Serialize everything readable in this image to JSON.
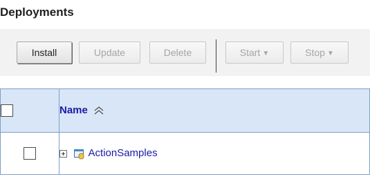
{
  "page": {
    "title": "Deployments"
  },
  "toolbar": {
    "install_label": "Install",
    "update_label": "Update",
    "delete_label": "Delete",
    "start_label": "Start",
    "stop_label": "Stop"
  },
  "table": {
    "columns": [
      {
        "label": "Name",
        "sort_icon": "sort-icon"
      }
    ],
    "rows": [
      {
        "name": "ActionSamples",
        "icon": "application-icon",
        "expand_icon": "expand-icon"
      }
    ]
  },
  "colors": {
    "header_bg": "#d9e6f7",
    "link": "#1a1aa6",
    "toolbar_bg": "#f2f2f2",
    "border": "#7aa0c7"
  }
}
